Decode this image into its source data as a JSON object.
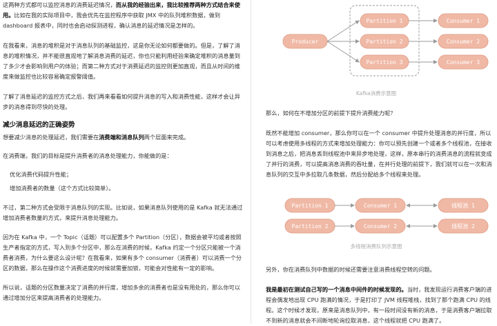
{
  "left": {
    "p1_a": "这两种方式都可以监控消息的消费延迟情况，",
    "p1_b": "而从我的经验出来，我比较推荐两种方式结合来使用。",
    "p1_c": "比如在我的实际项目中，我会优先在监控程序中获取 JMX 中的队列堆积数据，做到 dashboard 报表中，同时也会启动探测进程，确认消息的延迟情况是怎样的。",
    "p2": "在我看来，消息的堆积是对于消息队列的基础监控，这是你无论如何都要做的。但是，了解了消息的堆积情况，并不能很直观地了解消息消费的延迟，你也只能利用经验来确定堆积的消息量到了多少才会影响到用户的体验；而第二种方式对于消费延迟的监控则更加直观，而且从时间的维度来做监控也比较容易确定报警阈值。",
    "p3": "了解了消息延迟的监控方式之后，我们再来看看如何提升消息的写入和消费性能，这样才会让异步的消息得到尽快的处理。",
    "h2": "减少消息延迟的正确姿势",
    "p4_a": "想要减少消息的处理延迟，我们需要在",
    "p4_b": "消费端和消息队列",
    "p4_c": "两个层面来完成。",
    "p5": "在消费端，我们的目标是提升消费者的消息处理能力，你能做的是：",
    "li1": "优化消费代码提升性能；",
    "li2": "增加消费者的数量（这个方式比较简单）。",
    "p6": "不过，第二种方式会受限于消息队列的实现。比如说，如果消息队列使用的是 Kafka 就无法通过增加消费者数量的方式，来提升消息处理能力。",
    "p7": "因为在 Kafka 中，一个 Topic（话题）可以配置多个 Partition（分区），数据会被平均或者按照生产者指定的方式，写入到多个分区中，那么在消费的时候，Kafka 约定一个分区只能被一个消费者消费，为什么要这么设计呢？在我看来，如果有多个 consumer（消费者）可以消费一个分区的数据，那么在操作这个消费进度的时候就需要加锁，可能会对性能有一定的影响。",
    "p8": "所以说，话题的分区数量决定了消费的并行度，增加多余的消费者也是没有用处的，那么你可以通过增加分区来提高消费者的处理能力。"
  },
  "right": {
    "q1": "那么，如何在不增加分区的前提下提升消费能力呢？",
    "p1": "既然不能增加 consumer，那么你可以在一个 consumer 中提升处理消息的并行度，所以可以考虑使用多线程的方式来增加处理能力：你可以预先创建一个或者多个线程池，在接收到消息之后，把消息丢到线程池中来异步地处理，这样，原本串行的消费消息的流程就变成了并行的消费，可以提高消息消费的吞吐量，在并行处理的前提下，我们就可以在一次和消息队列的交互中多拉取几条数据，然后分配给多个线程来处理。",
    "p2": "另外，你在消费队列中数据的时候还需要注意消费线程空转的问题。",
    "p3_a": "我是最初在测试自己写的一个消息中间件的时候发现的。",
    "p3_b": "当时，我发现运行消费客户端的进程会偶发地出现 CPU 跑满的情况，于是打印了 JVM 线程堆栈，找到了那个跑满 CPU 的线程。这个时候才发现，原来是消息队列中，有一段时间没有新的消息，于是消费客户端拉取不到新的消息就会不间断地轮询拉取消息，这个线程就把 CPU 跑满了。"
  },
  "diagram1": {
    "producer": "Producer",
    "partitions": [
      "Partition 1",
      "Partition 2",
      "Partition 3"
    ],
    "consumers": [
      "Consumer 1",
      "Consumer 2",
      "Consumer 3"
    ],
    "caption": "Kafka消费示意图"
  },
  "diagram2": {
    "partitions": [
      "Partition 1",
      "Partition 2"
    ],
    "consumers": [
      "Consumer 1",
      "Consumer 2"
    ],
    "pools": [
      "线程池 1",
      "线程池 2"
    ],
    "caption": "多线程消费队列示意图"
  },
  "colors": {
    "box_fill": "#f0b9a6",
    "box_stroke": "#e2a38c",
    "text": "#ffffff",
    "arrow": "#9a9a9a"
  }
}
